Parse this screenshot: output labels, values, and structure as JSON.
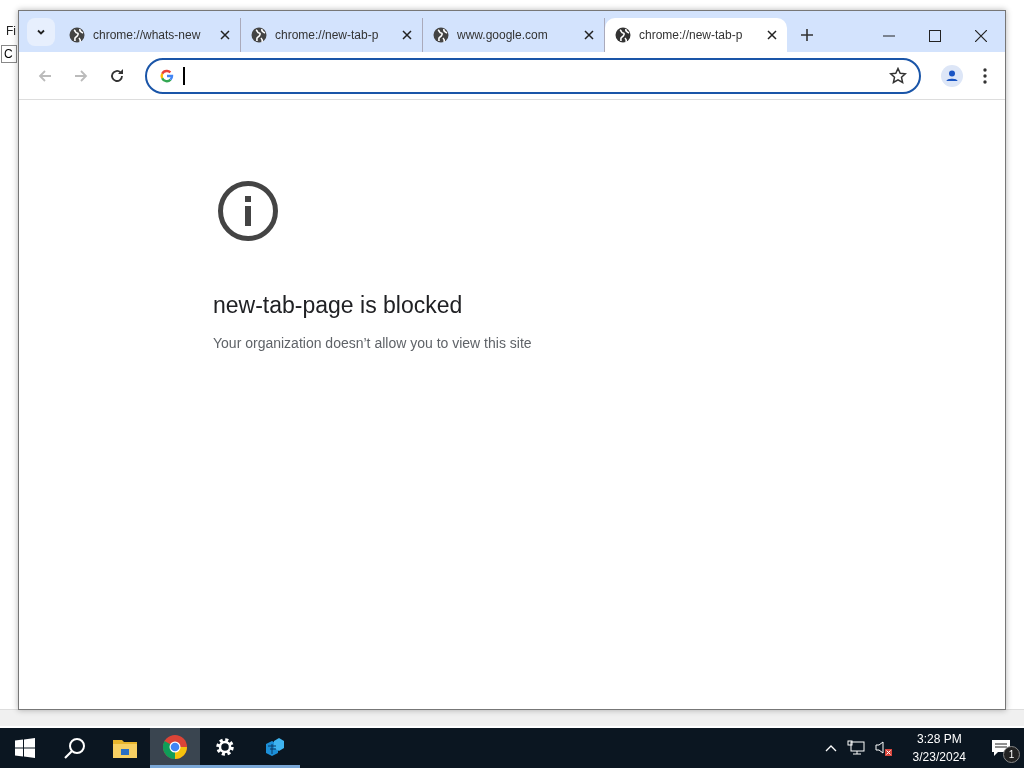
{
  "background_window": {
    "menu_text": "Fi",
    "field_text": "C"
  },
  "browser": {
    "tabs": [
      {
        "title": "chrome://whats-new",
        "selected": false
      },
      {
        "title": "chrome://new-tab-p",
        "selected": false
      },
      {
        "title": "www.google.com",
        "selected": false
      },
      {
        "title": "chrome://new-tab-p",
        "selected": true
      }
    ],
    "page": {
      "heading": "new-tab-page is blocked",
      "message": "Your organization doesn’t allow you to view this site"
    }
  },
  "taskbar": {
    "apps": [
      {
        "kind": "start",
        "running": false,
        "selected": false
      },
      {
        "kind": "search",
        "running": false,
        "selected": false
      },
      {
        "kind": "explorer",
        "running": false,
        "selected": false
      },
      {
        "kind": "chrome",
        "running": true,
        "selected": true
      },
      {
        "kind": "settings",
        "running": true,
        "selected": false
      },
      {
        "kind": "registry",
        "running": true,
        "selected": false
      }
    ],
    "clock": {
      "time": "3:28 PM",
      "date": "3/23/2024"
    },
    "notifications": "1"
  }
}
